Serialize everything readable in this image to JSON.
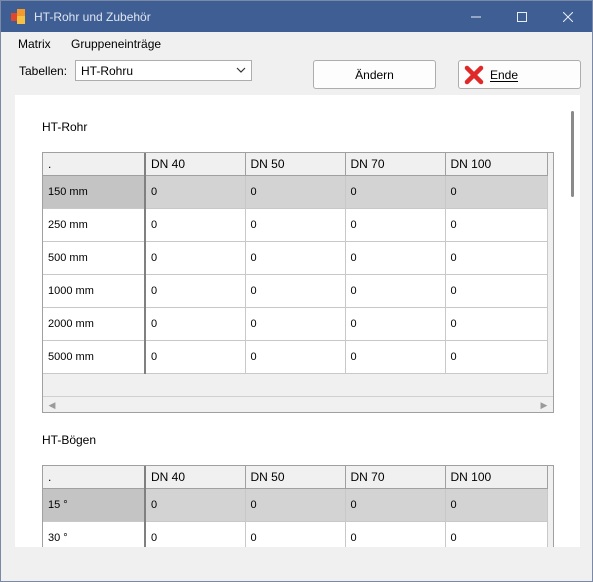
{
  "window": {
    "title": "HT-Rohr und Zubehör"
  },
  "menu": {
    "items": [
      "Matrix",
      "Gruppeneinträge"
    ]
  },
  "toolbar": {
    "tables_label": "Tabellen:",
    "tables_value": "HT-Rohru",
    "change_label": "Ändern",
    "end_label": "Ende"
  },
  "sections": [
    {
      "title": "HT-Rohr",
      "corner": ".",
      "columns": [
        "DN 40",
        "DN 50",
        "DN 70",
        "DN 100"
      ],
      "rows": [
        {
          "label": "150 mm",
          "values": [
            "0",
            "0",
            "0",
            "0"
          ],
          "selected": true
        },
        {
          "label": "250 mm",
          "values": [
            "0",
            "0",
            "0",
            "0"
          ]
        },
        {
          "label": "500 mm",
          "values": [
            "0",
            "0",
            "0",
            "0"
          ]
        },
        {
          "label": "1000 mm",
          "values": [
            "0",
            "0",
            "0",
            "0"
          ]
        },
        {
          "label": "2000 mm",
          "values": [
            "0",
            "0",
            "0",
            "0"
          ]
        },
        {
          "label": "5000 mm",
          "values": [
            "0",
            "0",
            "0",
            "0"
          ]
        }
      ]
    },
    {
      "title": "HT-Bögen",
      "corner": ".",
      "columns": [
        "DN 40",
        "DN 50",
        "DN 70",
        "DN 100"
      ],
      "rows": [
        {
          "label": "15 °",
          "values": [
            "0",
            "0",
            "0",
            "0"
          ],
          "selected": true
        },
        {
          "label": "30 °",
          "values": [
            "0",
            "0",
            "0",
            "0"
          ]
        }
      ]
    }
  ],
  "colors": {
    "titlebar": "#3f5e93",
    "selected_row": "#d3d3d3",
    "close_x": "#e02828"
  }
}
